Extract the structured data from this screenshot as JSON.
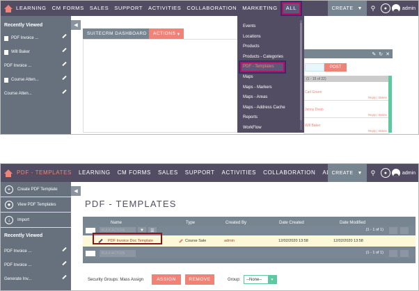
{
  "top": {
    "nav": [
      "LEARNING",
      "CM FORMS",
      "SALES",
      "SUPPORT",
      "ACTIVITIES",
      "COLLABORATION",
      "MARKETING",
      "ALL"
    ],
    "create": "CREATE",
    "user": "admin",
    "sidebar_title": "Recently Viewed",
    "sidebar": [
      "PDF Invoice ...",
      "Will Baker",
      "PDF Invoice ...",
      "Course Atten...",
      "Course Atten..."
    ],
    "dashboard_tab": "SUITECRM DASHBOARD",
    "actions": "ACTIONS",
    "dropdown": [
      "Events",
      "Locations",
      "Products",
      "Products - Categories",
      "PDF - Templates",
      "Maps",
      "Maps - Markers",
      "Maps - Areas",
      "Maps - Address Cache",
      "Reports",
      "WorkFlow"
    ],
    "dashlet": {
      "post": "POST",
      "pager": "(1 - 15 of 22)",
      "rows": [
        {
          "name": "Carl Green",
          "r": "Reply | Delete"
        },
        {
          "name": "Jenny Dean",
          "r": "Reply | Delete"
        },
        {
          "name": "Will Baker",
          "r": "Reply | Delete"
        }
      ]
    }
  },
  "bottom": {
    "current": "PDF - TEMPLATES",
    "nav": [
      "LEARNING",
      "CM FORMS",
      "SALES",
      "SUPPORT",
      "ACTIVITIES",
      "COLLABORATION",
      "ALL"
    ],
    "create": "CREATE",
    "user": "admin",
    "actions": [
      "Create PDF Template",
      "View PDF Templates",
      "Import"
    ],
    "sidebar_title": "Recently Viewed",
    "sidebar": [
      "PDF Invoice ...",
      "PDF Invoice ...",
      "Generate Inv..."
    ],
    "title": "PDF - TEMPLATES",
    "headers": {
      "name": "Name",
      "type": "Type",
      "created_by": "Created By",
      "date_created": "Date Created",
      "date_modified": "Date Modified"
    },
    "bulk": "BULK ACTION",
    "pager": "(1 - 1 of 1)",
    "row": {
      "name": "PDF Invoice Doc Template",
      "type": "Course Sale",
      "created_by": "admin",
      "date_created": "12/02/2020 13:58",
      "date_modified": "12/02/2020 13:58"
    },
    "security_label": "Security Groups: Mass Assign",
    "assign": "ASSIGN",
    "remove": "REMOVE",
    "group_label": "Group:",
    "group_value": "--None--"
  }
}
